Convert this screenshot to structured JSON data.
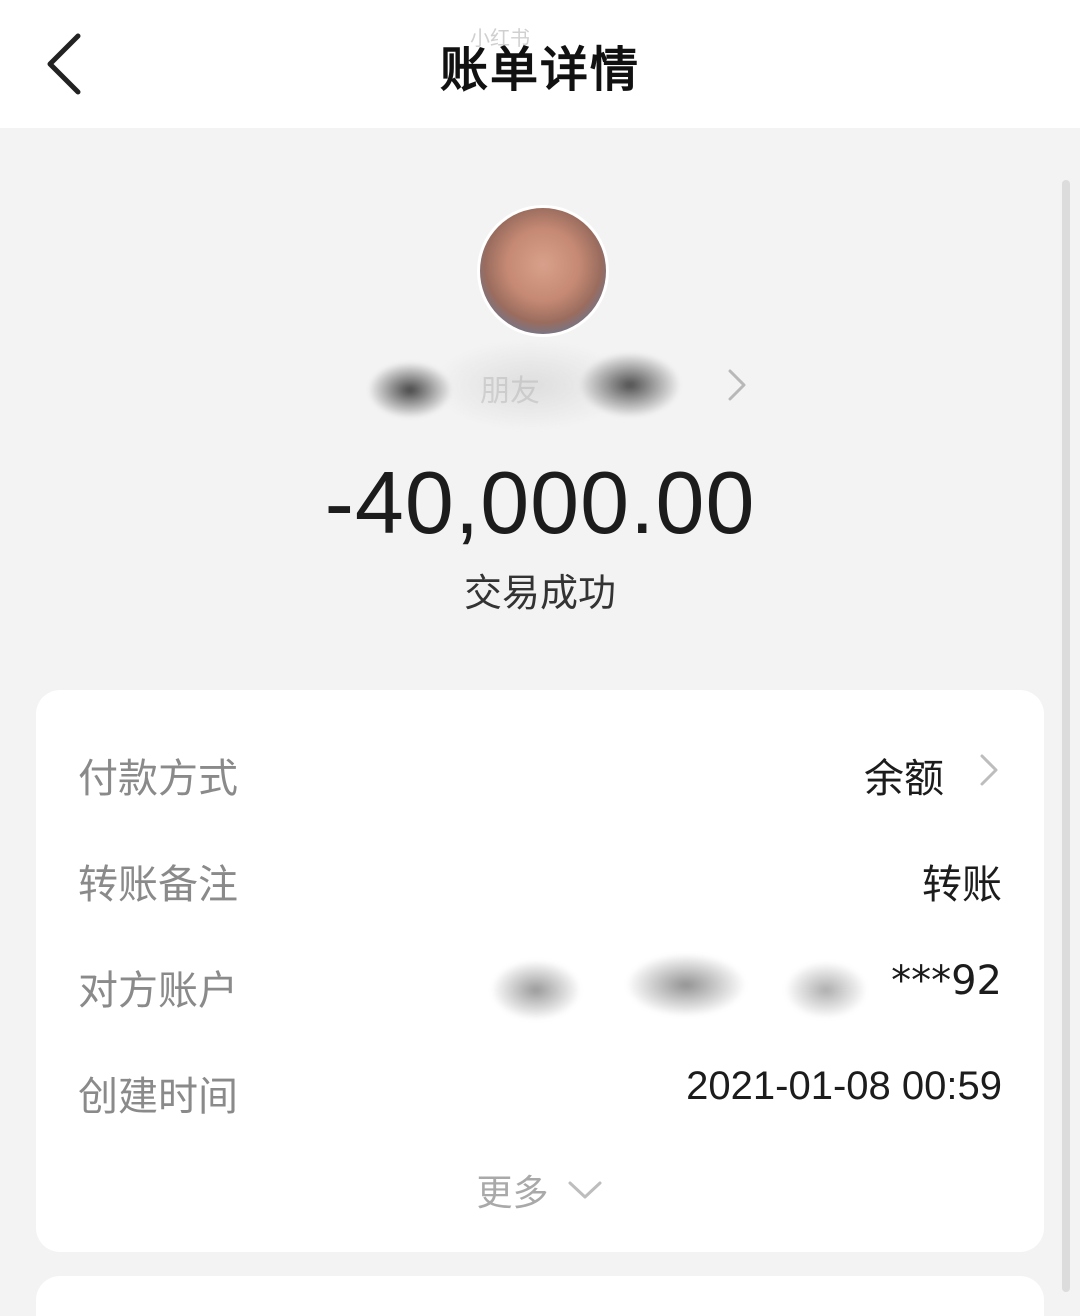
{
  "header": {
    "title": "账单详情",
    "watermark": "小红书"
  },
  "payee": {
    "name": "朋友"
  },
  "transaction": {
    "amount": "-40,000.00",
    "status": "交易成功"
  },
  "details": {
    "payment_method": {
      "label": "付款方式",
      "value": "余额"
    },
    "remark": {
      "label": "转账备注",
      "value": "转账"
    },
    "counterparty": {
      "label": "对方账户",
      "value": "***92"
    },
    "created_time": {
      "label": "创建时间",
      "value": "2021-01-08 00:59"
    }
  },
  "more": {
    "label": "更多"
  },
  "colors": {
    "background": "#f3f3f3",
    "card": "#ffffff",
    "label_text": "#8a8a8a",
    "value_text": "#1c1c1c"
  }
}
